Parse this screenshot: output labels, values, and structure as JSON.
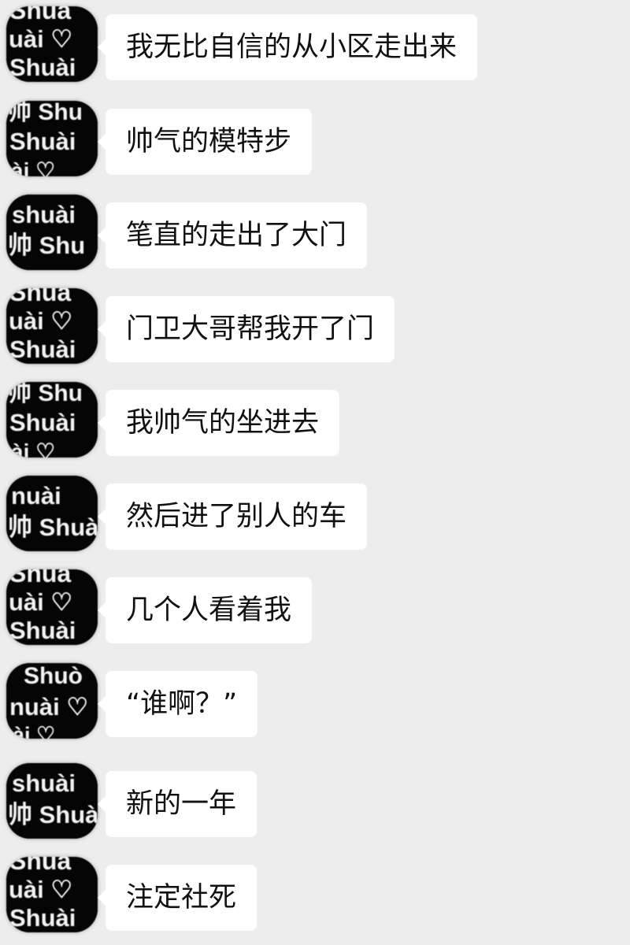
{
  "messages": [
    {
      "text": "我无比自信的从小区走出来",
      "avatar": {
        "icon": "avatar-shuai-pattern",
        "lines": [
          "Shuà",
          "uài ♡",
          "Shuài"
        ]
      }
    },
    {
      "text": "帅气的模特步",
      "avatar": {
        "icon": "avatar-shuai-pattern",
        "lines": [
          "帅 Shu",
          "Shuài",
          "ài ♡"
        ]
      }
    },
    {
      "text": "笔直的走出了大门",
      "avatar": {
        "icon": "avatar-shuai-pattern",
        "lines": [
          "shuài",
          "帅 Shu"
        ]
      }
    },
    {
      "text": "门卫大哥帮我开了门",
      "avatar": {
        "icon": "avatar-shuai-pattern",
        "lines": [
          "Shuà",
          "uài ♡",
          "Shuài"
        ]
      }
    },
    {
      "text": "我帅气的坐进去",
      "avatar": {
        "icon": "avatar-shuai-pattern",
        "lines": [
          "帅 Shu",
          "Shuài",
          "ài ♡"
        ]
      }
    },
    {
      "text": "然后进了别人的车",
      "avatar": {
        "icon": "avatar-shuai-pattern",
        "lines": [
          "nuài",
          "帅 Shuà"
        ]
      }
    },
    {
      "text": "几个人看着我",
      "avatar": {
        "icon": "avatar-shuai-pattern",
        "lines": [
          "Shuà",
          "uài ♡",
          "Shuài"
        ]
      }
    },
    {
      "text": "“谁啊？”",
      "avatar": {
        "icon": "avatar-shuai-pattern",
        "lines": [
          "Shuò",
          "nuài ♡",
          "ài ♡"
        ]
      }
    },
    {
      "text": "新的一年",
      "avatar": {
        "icon": "avatar-shuai-pattern",
        "lines": [
          "shuài",
          "帅 Shuà"
        ]
      }
    },
    {
      "text": "注定社死",
      "avatar": {
        "icon": "avatar-shuai-pattern",
        "lines": [
          "Shuà",
          "uài ♡",
          "Shuài"
        ]
      }
    }
  ]
}
